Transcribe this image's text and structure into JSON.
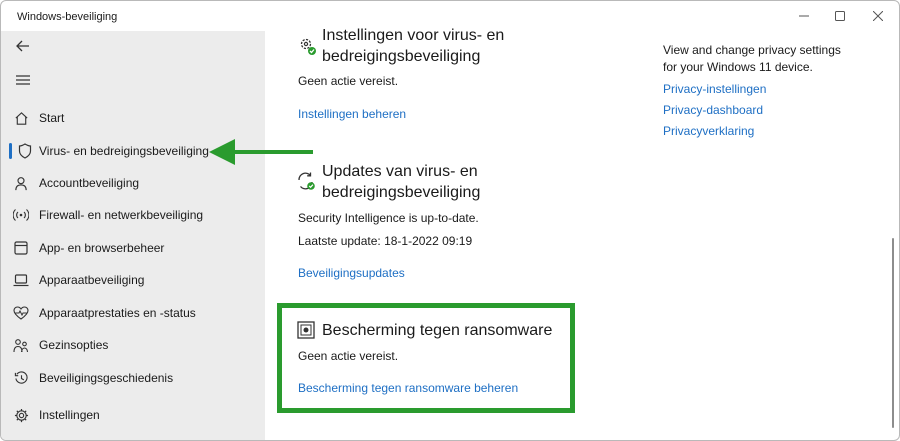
{
  "window": {
    "title": "Windows-beveiliging"
  },
  "sidebar": {
    "items": [
      {
        "label": "Start",
        "icon": "home-icon",
        "selected": false
      },
      {
        "label": "Virus- en bedreigingsbeveiliging",
        "icon": "shield-icon",
        "selected": true
      },
      {
        "label": "Accountbeveiliging",
        "icon": "person-icon",
        "selected": false
      },
      {
        "label": "Firewall- en netwerkbeveiliging",
        "icon": "wifi-signal-icon",
        "selected": false
      },
      {
        "label": "App- en browserbeheer",
        "icon": "browser-window-icon",
        "selected": false
      },
      {
        "label": "Apparaatbeveiliging",
        "icon": "laptop-icon",
        "selected": false
      },
      {
        "label": "Apparaatprestaties en -status",
        "icon": "heart-pulse-icon",
        "selected": false
      },
      {
        "label": "Gezinsopties",
        "icon": "family-icon",
        "selected": false
      },
      {
        "label": "Beveiligingsgeschiedenis",
        "icon": "history-icon",
        "selected": false
      },
      {
        "label": "Instellingen",
        "icon": "gear-icon",
        "selected": false
      }
    ]
  },
  "main": {
    "settings_section": {
      "title": "Instellingen voor virus- en bedreigingsbeveiliging",
      "status": "Geen actie vereist.",
      "link": "Instellingen beheren",
      "icon": "gear-check-icon"
    },
    "updates_section": {
      "title": "Updates van virus- en bedreigingsbeveiliging",
      "status": "Security Intelligence is up-to-date.",
      "last_update": "Laatste update: 18-1-2022 09:19",
      "link": "Beveiligingsupdates",
      "icon": "refresh-check-icon"
    },
    "ransomware_section": {
      "title": "Bescherming tegen ransomware",
      "status": "Geen actie vereist.",
      "link": "Bescherming tegen ransomware beheren",
      "icon": "ransomware-folder-icon"
    }
  },
  "privacy": {
    "description_line1": "View and change privacy settings",
    "description_line2": "for your Windows 11 device.",
    "links": [
      "Privacy-instellingen",
      "Privacy-dashboard",
      "Privacyverklaring"
    ]
  },
  "colors": {
    "accent": "#1e6fc4",
    "annotation_green": "#2a9b2e",
    "sidebar_bg": "#ececec"
  }
}
